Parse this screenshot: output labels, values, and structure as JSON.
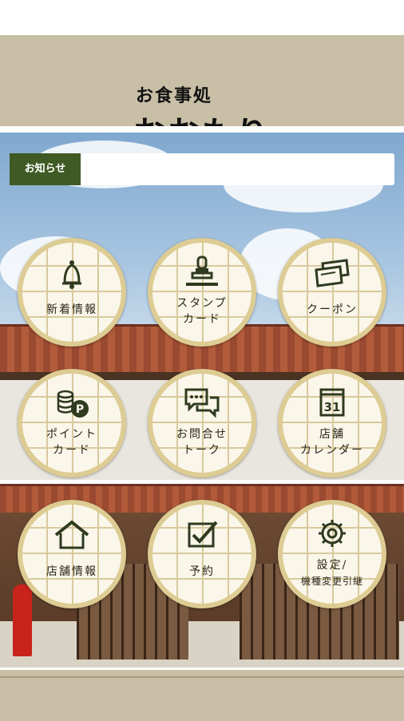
{
  "header": {
    "subtitle": "お食事処",
    "title": "おおもり"
  },
  "notice": {
    "label": "お知らせ",
    "value": ""
  },
  "menu": [
    {
      "id": "news",
      "icon": "bell-icon",
      "lines": [
        "新着情報"
      ]
    },
    {
      "id": "stamp",
      "icon": "stamp-icon",
      "lines": [
        "スタンプ",
        "カード"
      ]
    },
    {
      "id": "coupon",
      "icon": "coupon-icon",
      "lines": [
        "クーポン"
      ]
    },
    {
      "id": "point",
      "icon": "point-coins-icon",
      "lines": [
        "ポイント",
        "カード"
      ]
    },
    {
      "id": "inquiry",
      "icon": "chat-bubbles-icon",
      "lines": [
        "お問合せ",
        "トーク"
      ]
    },
    {
      "id": "calendar",
      "icon": "calendar-icon",
      "lines": [
        "店舗",
        "カレンダー"
      ],
      "calendar_day": "31"
    },
    {
      "id": "shop",
      "icon": "house-icon",
      "lines": [
        "店舗情報"
      ]
    },
    {
      "id": "reservation",
      "icon": "checkbox-icon",
      "lines": [
        "予約"
      ]
    },
    {
      "id": "settings",
      "icon": "gear-icon",
      "lines": [
        "設定/",
        "機種変更引継"
      ]
    }
  ]
}
